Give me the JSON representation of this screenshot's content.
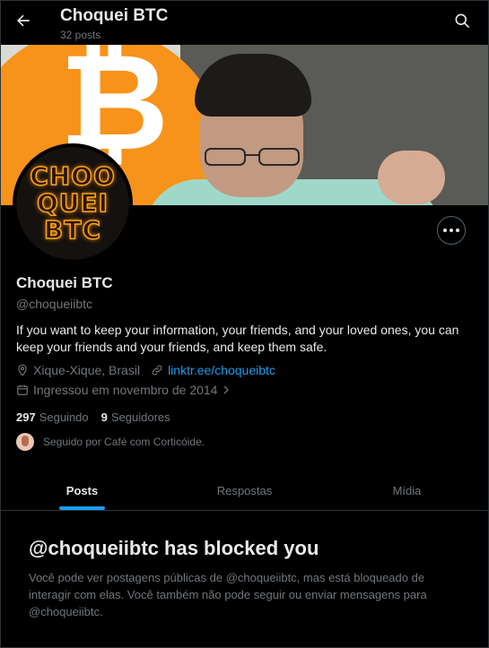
{
  "header": {
    "title": "Choquei BTC",
    "posts_count": "32 posts"
  },
  "avatar": {
    "lines": [
      "CHOO",
      "QUEI",
      "BTC"
    ]
  },
  "profile": {
    "name": "Choquei BTC",
    "handle": "@choqueiibtc",
    "bio": "If you want to keep your information, your friends, and your loved ones, you can keep your friends and your friends, and keep them safe.",
    "location": "Xique-Xique, Brasil",
    "link": "linktr.ee/choqueibtc",
    "joined": "Ingressou em novembro de 2014",
    "following_count": "297",
    "following_label": "Seguindo",
    "followers_count": "9",
    "followers_label": "Seguidores",
    "followed_by": "Seguido por Café com Corticóide."
  },
  "tabs": [
    {
      "label": "Posts",
      "active": true
    },
    {
      "label": "Respostas",
      "active": false
    },
    {
      "label": "Mídia",
      "active": false
    }
  ],
  "blocked": {
    "title": "@choqueiibtc has blocked you",
    "text": "Você pode ver postagens públicas de @choqueiibtc, mas está bloqueado de interagir com elas. Você também não pode seguir ou enviar mensagens para @choqueiibtc."
  },
  "icons": {
    "back": "arrow-left-icon",
    "search": "search-icon",
    "more": "more-icon",
    "location": "location-icon",
    "link": "link-icon",
    "calendar": "calendar-icon"
  },
  "colors": {
    "accent": "#1d9bf0",
    "background": "#000000",
    "muted_text": "#71767b",
    "btc_orange": "#f7931a"
  }
}
